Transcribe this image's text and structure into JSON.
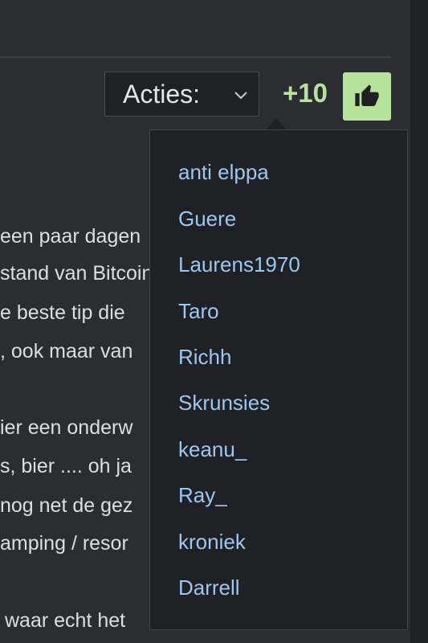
{
  "header": {
    "actions_label": "Acties:",
    "score": "+10"
  },
  "post": {
    "lines": [
      "een paar dagen",
      "stand van Bitcoin",
      "e beste tip die",
      ", ook maar van",
      "ier een onderw",
      "s, bier .... oh ja",
      "nog net de gez",
      "amping / resor",
      "waar echt het"
    ]
  },
  "reactions": {
    "users": [
      "anti elppa",
      "Guere",
      "Laurens1970",
      "Taro",
      "Richh",
      "Skrunsies",
      "keanu_",
      "Ray_",
      "kroniek",
      "Darrell"
    ]
  },
  "colors": {
    "background": "#2b2d31",
    "accent": "#b6e39b",
    "link": "#9cc7f3",
    "dropdown_bg": "#1f2124"
  }
}
